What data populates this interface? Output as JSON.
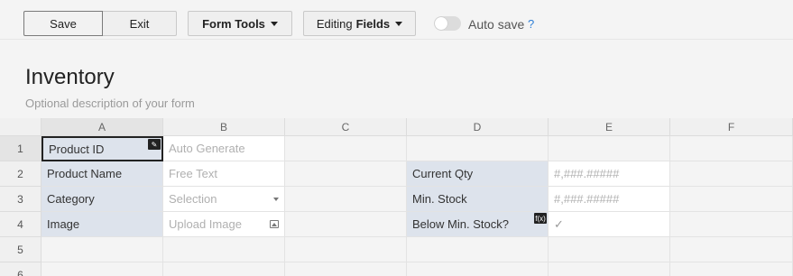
{
  "toolbar": {
    "save_label": "Save",
    "exit_label": "Exit",
    "form_tools_label": "Form Tools",
    "editing_prefix": "Editing",
    "editing_bold": "Fields",
    "autosave_label": "Auto save",
    "autosave_on": false,
    "help_label": "?"
  },
  "form": {
    "title": "Inventory",
    "description": "Optional description of your form"
  },
  "grid": {
    "columns": [
      "A",
      "B",
      "C",
      "D",
      "E",
      "F"
    ],
    "rows": [
      "1",
      "2",
      "3",
      "4",
      "5",
      "6"
    ],
    "cells": {
      "a1": "Product ID",
      "b1": "Auto Generate",
      "a2": "Product Name",
      "b2": "Free Text",
      "a3": "Category",
      "b3": "Selection",
      "a4": "Image",
      "b4": "Upload Image",
      "d2": "Current Qty",
      "e2": "#,###.#####",
      "d3": "Min. Stock",
      "e3": "#,###.#####",
      "d4": "Below Min. Stock?",
      "e4_icon": "checkmark-icon",
      "d4_badge": "f(x)"
    }
  },
  "colors": {
    "label_bg": "#dde3ec",
    "link": "#2f7fd6"
  }
}
